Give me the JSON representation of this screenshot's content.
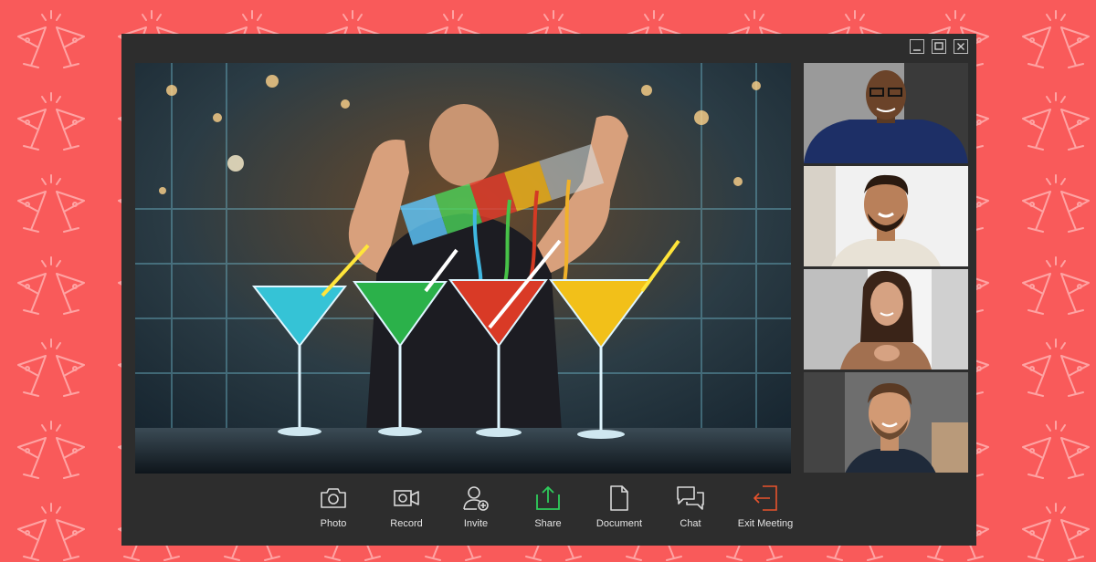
{
  "window": {
    "controls": [
      "minimize",
      "maximize",
      "close"
    ]
  },
  "main_video": {
    "subject": "bartender pouring colored drinks into martini glasses",
    "glasses": [
      "blue",
      "green",
      "red",
      "yellow"
    ]
  },
  "participants": [
    {
      "name": "",
      "icon": "participant-1"
    },
    {
      "name": "",
      "icon": "participant-2"
    },
    {
      "name": "",
      "icon": "participant-3"
    },
    {
      "name": "",
      "icon": "participant-4"
    }
  ],
  "toolbar": {
    "photo_label": "Photo",
    "record_label": "Record",
    "invite_label": "Invite",
    "share_label": "Share",
    "document_label": "Document",
    "chat_label": "Chat",
    "exit_label": "Exit Meeting"
  },
  "colors": {
    "background": "#f95a5a",
    "pattern": "#ffb4b4",
    "window": "#2d2d2d",
    "icon": "#d9d9d9",
    "share": "#2ecc5b",
    "exit": "#e8532d"
  }
}
